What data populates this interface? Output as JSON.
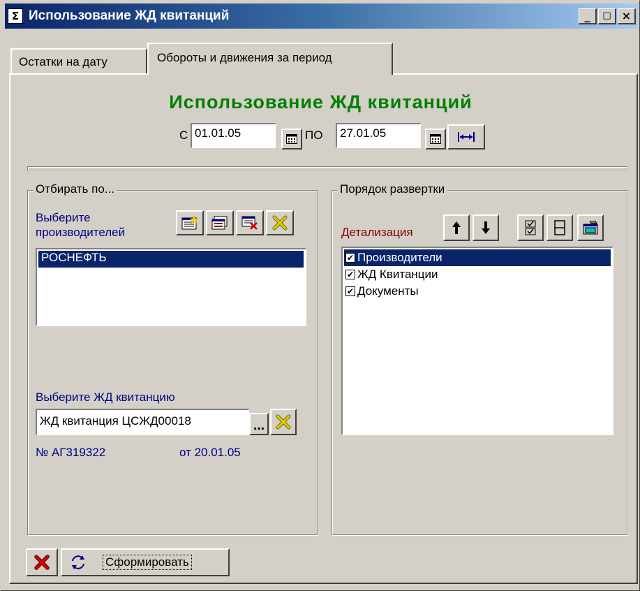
{
  "window": {
    "title": "Использование ЖД квитанций",
    "app_icon": "sigma-icon",
    "buttons": [
      "_",
      "□",
      "×"
    ]
  },
  "tabs": [
    {
      "label": "Остатки на дату",
      "active": false
    },
    {
      "label": "Обороты и движения за период",
      "active": true
    }
  ],
  "heading": "Использование ЖД квитанций",
  "period": {
    "from_label": "С",
    "from_value": "01.01.05",
    "to_label": "ПО",
    "to_value": "27.01.05"
  },
  "filter_group": {
    "caption": "Отбирать по...",
    "producers_label": "Выберите производителей",
    "producers": [
      {
        "name": "РОСНЕФТЬ",
        "selected": true
      }
    ],
    "receipt_label": "Выберите ЖД квитанцию",
    "receipt_value": "ЖД квитанция ЦСЖД00018",
    "receipt_number": "№ АГ319322",
    "receipt_date": "от 20.01.05"
  },
  "order_group": {
    "caption": "Порядок развертки",
    "detail_label": "Детализация",
    "items": [
      {
        "label": "Производители",
        "checked": true,
        "selected": true
      },
      {
        "label": "ЖД Квитанции",
        "checked": true,
        "selected": false
      },
      {
        "label": "Документы",
        "checked": true,
        "selected": false
      }
    ]
  },
  "footer": {
    "generate_label": "Сформировать"
  },
  "colors": {
    "heading": "#008000",
    "label_blue": "#000080",
    "label_darkred": "#800000",
    "selection": "#0a246a",
    "face": "#d4d0c8"
  }
}
